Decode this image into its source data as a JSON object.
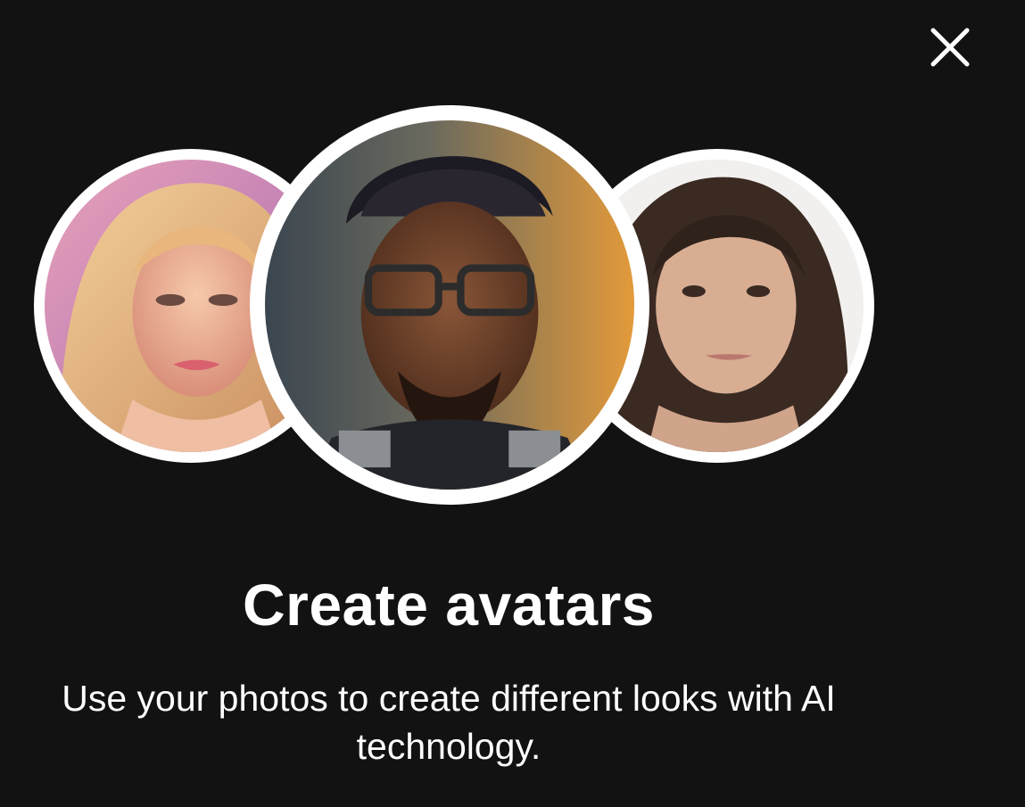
{
  "dialog": {
    "close_icon": "close-icon",
    "title": "Create avatars",
    "description_line1": "Use your photos to create different looks with AI",
    "description_line2": "technology."
  },
  "avatars": [
    {
      "name": "illustrated-woman-avatar"
    },
    {
      "name": "sci-fi-man-avatar"
    },
    {
      "name": "photo-woman-avatar"
    }
  ],
  "colors": {
    "background": "#121212",
    "text": "#ffffff",
    "avatar_border": "#ffffff"
  }
}
